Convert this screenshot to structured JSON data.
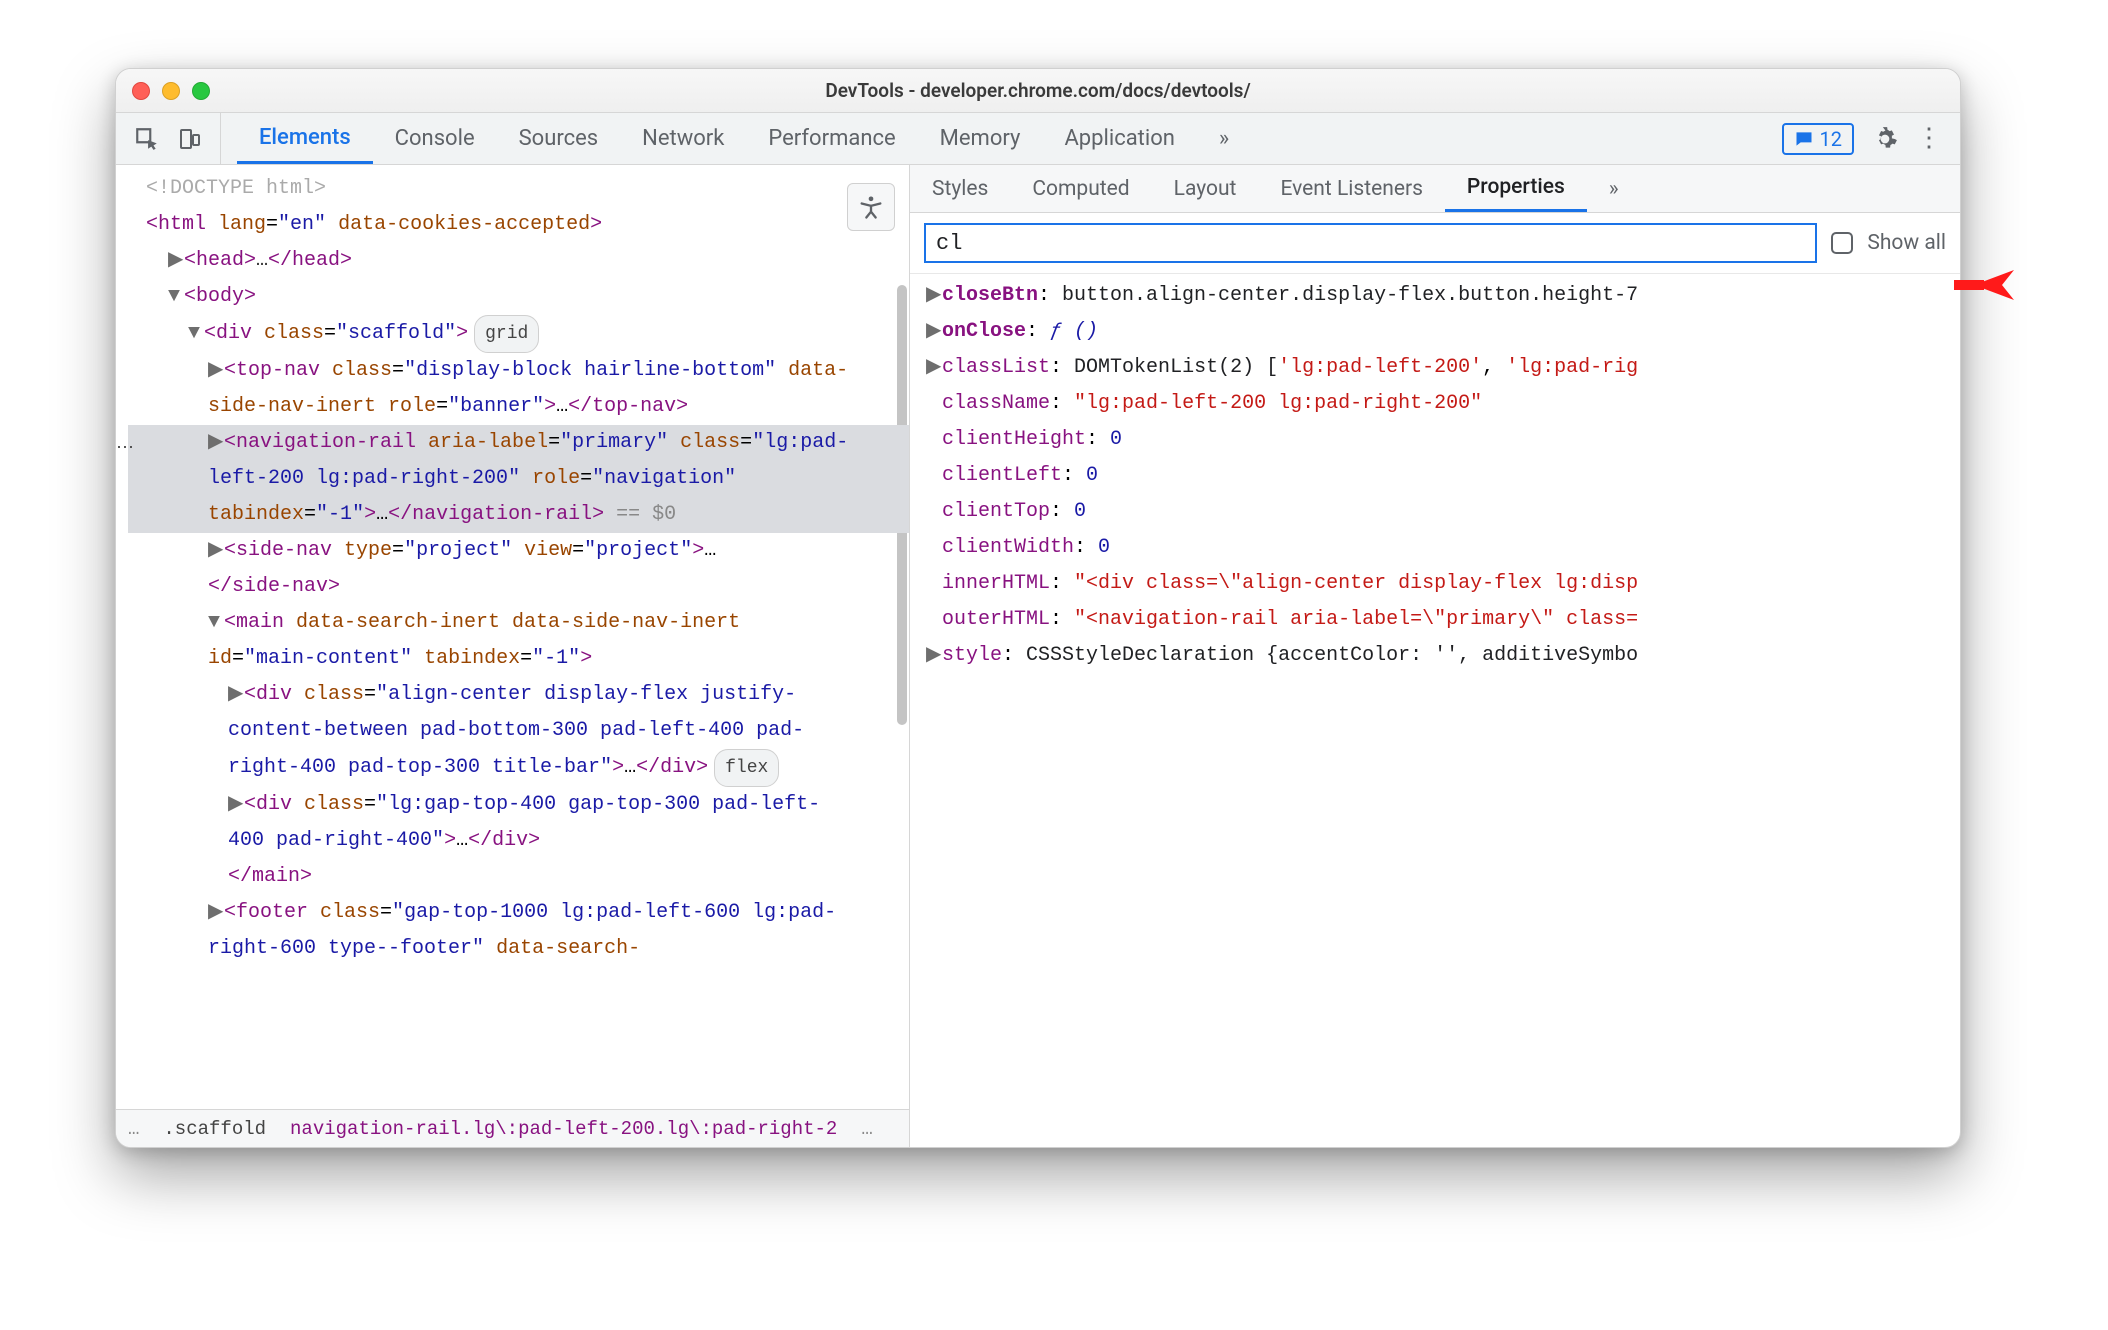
{
  "window": {
    "title": "DevTools - developer.chrome.com/docs/devtools/"
  },
  "toolbar": {
    "tabs": [
      "Elements",
      "Console",
      "Sources",
      "Network",
      "Performance",
      "Memory",
      "Application"
    ],
    "active_tab": "Elements",
    "overflow_glyph": "»",
    "messages_count": "12"
  },
  "dom": {
    "doctype": "<!DOCTYPE html>",
    "html_open": {
      "tag": "html",
      "attrs": [
        [
          "lang",
          "en"
        ]
      ],
      "flag_attr": "data-cookies-accepted"
    },
    "head_line": "…",
    "body_tag": "body",
    "scaffold": {
      "tag": "div",
      "attrs": [
        [
          "class",
          "scaffold"
        ]
      ],
      "badge": "grid"
    },
    "topnav": {
      "tag": "top-nav",
      "attr_class": "display-block hairline-bottom",
      "flags": "data-side-nav-inert",
      "role": "banner",
      "close": "top-nav"
    },
    "navrail": {
      "tag": "navigation-rail",
      "aria": "primary",
      "cls": "lg:pad-left-200 lg:pad-right-200",
      "role": "navigation",
      "tabindex": "-1",
      "trailer": "== $0"
    },
    "sidenav": {
      "tag": "side-nav",
      "type": "project",
      "view": "project"
    },
    "main": {
      "tag": "main",
      "flags": "data-search-inert data-side-nav-inert",
      "id": "main-content",
      "tabindex": "-1"
    },
    "titlebar_div": {
      "cls": "align-center display-flex justify-content-between pad-bottom-300 pad-left-400 pad-right-400 pad-top-300 title-bar",
      "badge": "flex"
    },
    "content_div": {
      "cls": "lg:gap-top-400 gap-top-300 pad-left-400 pad-right-400"
    },
    "footer": {
      "cls": "gap-top-1000 lg:pad-left-600 lg:pad-right-600 type--footer",
      "flag": "data-search-"
    }
  },
  "crumbs": {
    "ell": "…",
    "scaffold": ".scaffold",
    "rail": "navigation-rail.lg\\:pad-left-200.lg\\:pad-right-2",
    "ell2": "…"
  },
  "subtabs": {
    "items": [
      "Styles",
      "Computed",
      "Layout",
      "Event Listeners",
      "Properties"
    ],
    "active": "Properties",
    "overflow": "»"
  },
  "filter": {
    "value": "cl",
    "show_all_label": "Show all"
  },
  "props": {
    "closeBtn": {
      "key": "closeBtn",
      "val": "button.align-center.display-flex.button.height-7"
    },
    "onClose": {
      "key": "onClose",
      "fn": "ƒ ()"
    },
    "classList": {
      "key": "classList",
      "val": "DOMTokenList(2) ['lg:pad-left-200', 'lg:pad-rig"
    },
    "className": {
      "key": "className",
      "str": "\"lg:pad-left-200 lg:pad-right-200\""
    },
    "clientHeight": {
      "key": "clientHeight",
      "num": "0"
    },
    "clientLeft": {
      "key": "clientLeft",
      "num": "0"
    },
    "clientTop": {
      "key": "clientTop",
      "num": "0"
    },
    "clientWidth": {
      "key": "clientWidth",
      "num": "0"
    },
    "innerHTML": {
      "key": "innerHTML",
      "str": "\"<div class=\\\"align-center display-flex lg:disp"
    },
    "outerHTML": {
      "key": "outerHTML",
      "str": "\"<navigation-rail aria-label=\\\"primary\\\" class="
    },
    "style": {
      "key": "style",
      "val": "CSSStyleDeclaration {accentColor: '', additiveSymbo"
    }
  }
}
